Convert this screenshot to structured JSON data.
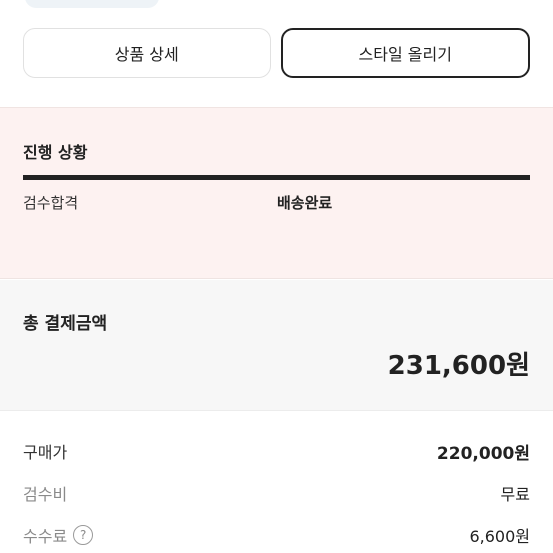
{
  "buttons": {
    "product_detail": "상품 상세",
    "upload_style": "스타일 올리기"
  },
  "progress": {
    "title": "진행 상황",
    "steps": [
      "검수합격",
      "배송완료"
    ],
    "progress_fraction": 1.0
  },
  "total": {
    "label": "총 결제금액",
    "value": "231,600원"
  },
  "summary": {
    "purchase_price_label": "구매가",
    "purchase_price_value": "220,000원",
    "inspection_fee_label": "검수비",
    "inspection_fee_value": "무료",
    "commission_label": "수수료",
    "commission_value": "6,600원",
    "help_icon": "question-circle-icon"
  }
}
